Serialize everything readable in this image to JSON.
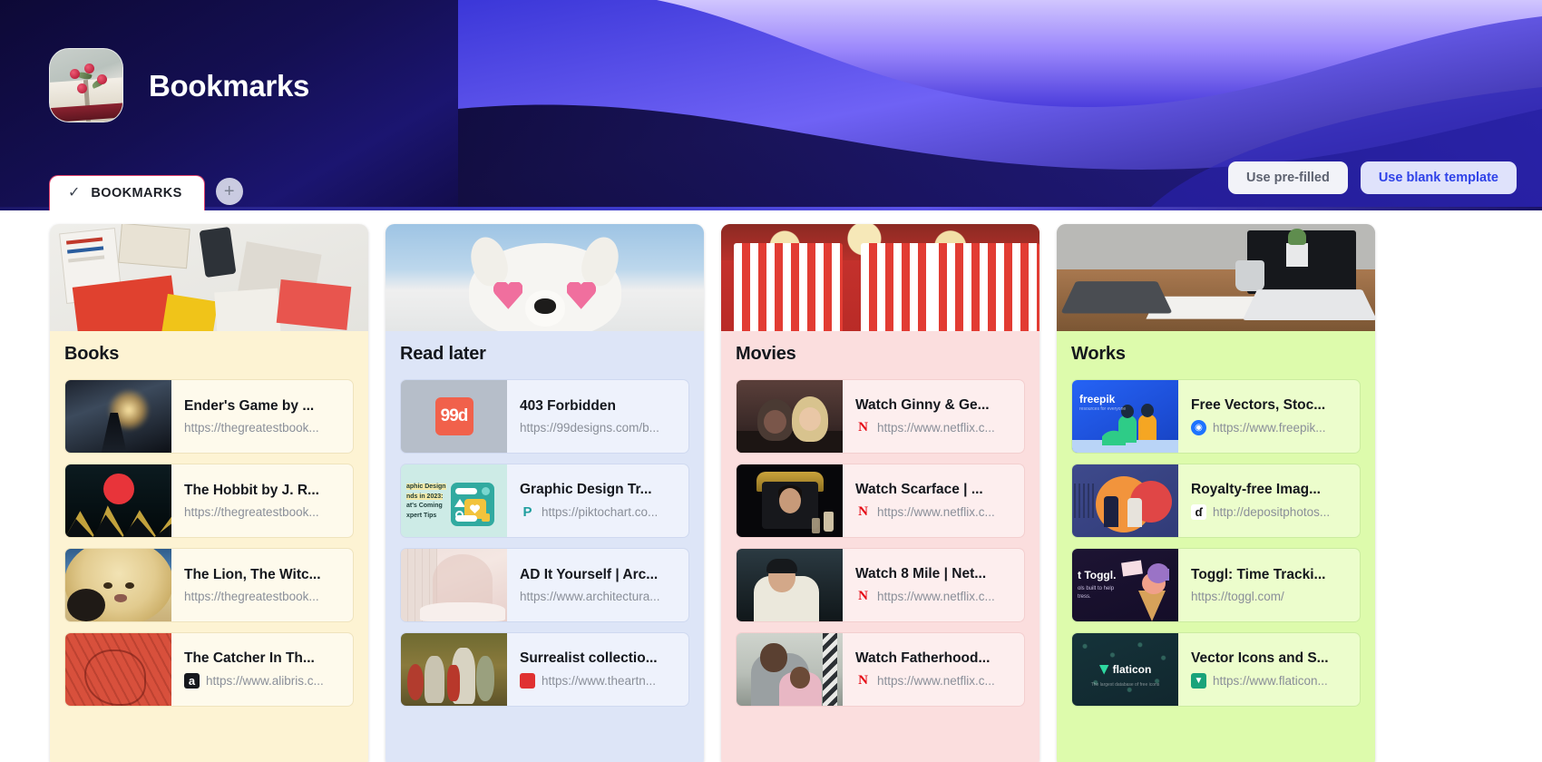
{
  "header": {
    "title": "Bookmarks",
    "avatar_icon": "book-with-flowers-avatar",
    "tab": {
      "label": "BOOKMARKS",
      "check_icon": "check-icon"
    },
    "add_tab_icon": "plus-icon",
    "buttons": {
      "prefilled": "Use pre-filled",
      "blank": "Use blank template"
    }
  },
  "board": {
    "columns": [
      {
        "title": "Books",
        "cover_icon": "books-on-desk-photo",
        "theme": "t-books",
        "items": [
          {
            "title": "Ender's Game by ...",
            "url": "https://thegreatestbook...",
            "favicon": "none",
            "thumb": "th-enders"
          },
          {
            "title": "The Hobbit by J. R...",
            "url": "https://thegreatestbook...",
            "favicon": "none",
            "thumb": "th-hobbit"
          },
          {
            "title": "The Lion, The Witc...",
            "url": "https://thegreatestbook...",
            "favicon": "none",
            "thumb": "th-lion"
          },
          {
            "title": "The Catcher In Th...",
            "url": "https://www.alibris.c...",
            "favicon": "amazon-icon",
            "favicon_text": "a",
            "thumb": "th-catcher"
          }
        ]
      },
      {
        "title": "Read later",
        "cover_icon": "dog-with-sunglasses-photo",
        "theme": "t-read",
        "items": [
          {
            "title": "403 Forbidden",
            "url": "https://99designs.com/b...",
            "favicon": "none",
            "thumb": "th-99"
          },
          {
            "title": "Graphic Design Tr...",
            "url": "https://piktochart.co...",
            "favicon": "piktochart-icon",
            "favicon_text": "P",
            "thumb": "th-pik"
          },
          {
            "title": "AD It Yourself | Arc...",
            "url": "https://www.architectura...",
            "favicon": "none",
            "thumb": "th-ad"
          },
          {
            "title": "Surrealist collectio...",
            "url": "https://www.theartn...",
            "favicon": "red-square-icon",
            "favicon_text": "",
            "thumb": "th-surreal"
          }
        ]
      },
      {
        "title": "Movies",
        "cover_icon": "popcorn-photo",
        "theme": "t-movies",
        "items": [
          {
            "title": "Watch Ginny & Ge...",
            "url": "https://www.netflix.c...",
            "favicon": "netflix-icon",
            "favicon_text": "N",
            "thumb": "th-ginny"
          },
          {
            "title": "Watch Scarface | ...",
            "url": "https://www.netflix.c...",
            "favicon": "netflix-icon",
            "favicon_text": "N",
            "thumb": "th-scar"
          },
          {
            "title": "Watch 8 Mile | Net...",
            "url": "https://www.netflix.c...",
            "favicon": "netflix-icon",
            "favicon_text": "N",
            "thumb": "th-8mile"
          },
          {
            "title": "Watch Fatherhood...",
            "url": "https://www.netflix.c...",
            "favicon": "netflix-icon",
            "favicon_text": "N",
            "thumb": "th-father"
          }
        ]
      },
      {
        "title": "Works",
        "cover_icon": "desk-with-laptop-photo",
        "theme": "t-works",
        "items": [
          {
            "title": "Free Vectors, Stoc...",
            "url": "https://www.freepik...",
            "favicon": "freepik-icon",
            "favicon_text": "◉",
            "thumb": "th-freepik"
          },
          {
            "title": "Royalty-free Imag...",
            "url": "http://depositphotos...",
            "favicon": "depositphotos-icon",
            "favicon_text": "ɗ",
            "thumb": "th-depo"
          },
          {
            "title": "Toggl: Time Tracki...",
            "url": "https://toggl.com/",
            "favicon": "none",
            "thumb": "th-toggl"
          },
          {
            "title": "Vector Icons and S...",
            "url": "https://www.flaticon...",
            "favicon": "flaticon-icon",
            "favicon_text": "▼",
            "thumb": "th-flat"
          }
        ]
      }
    ]
  }
}
